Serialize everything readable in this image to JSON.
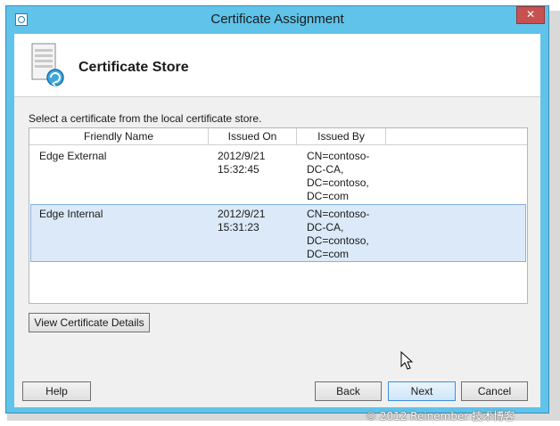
{
  "window": {
    "title": "Certificate Assignment",
    "close_glyph": "✕"
  },
  "header": {
    "title": "Certificate Store"
  },
  "instruction": "Select a certificate from the local certificate store.",
  "columns": [
    "Friendly Name",
    "Issued On",
    "Issued By"
  ],
  "rows": [
    {
      "name": "Edge External",
      "issued_on": [
        "2012/9/21",
        "15:32:45"
      ],
      "issued_by": [
        "CN=contoso-",
        "DC-CA,",
        "DC=contoso,",
        "DC=com"
      ],
      "selected": false
    },
    {
      "name": "Edge Internal",
      "issued_on": [
        "2012/9/21",
        "15:31:23"
      ],
      "issued_by": [
        "CN=contoso-",
        "DC-CA,",
        "DC=contoso,",
        "DC=com"
      ],
      "selected": true
    }
  ],
  "buttons": {
    "view_details": "View Certificate Details",
    "help": "Help",
    "back": "Back",
    "next": "Next",
    "cancel": "Cancel"
  },
  "watermark": "© 2012 Reinember 技术博客",
  "colors": {
    "frame": "#5fc3ea",
    "close": "#c75050",
    "selection": "#dbe9f8"
  }
}
